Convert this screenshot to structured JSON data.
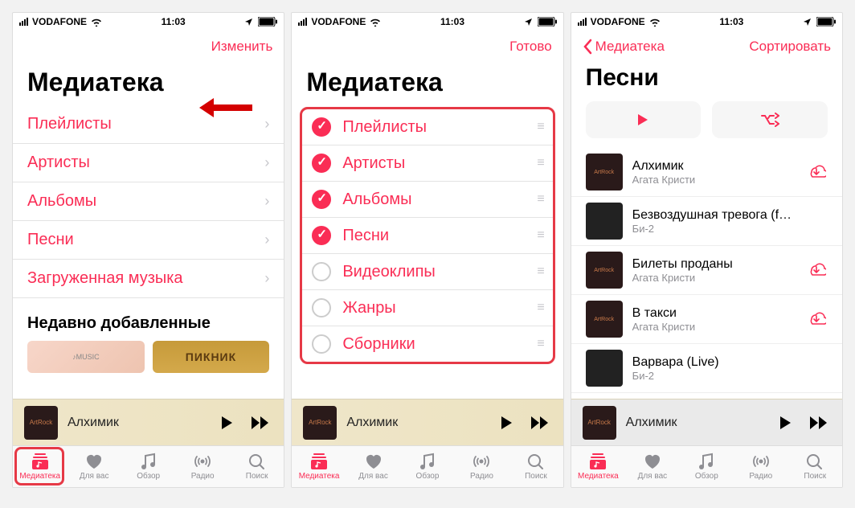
{
  "status": {
    "carrier": "VODAFONE",
    "time": "11:03"
  },
  "colors": {
    "accent": "#fa2d55"
  },
  "screen1": {
    "nav_right": "Изменить",
    "title": "Медиатека",
    "items": [
      "Плейлисты",
      "Артисты",
      "Альбомы",
      "Песни",
      "Загруженная музыка"
    ],
    "recent_header": "Недавно добавленные",
    "recent_album_label": "ПИКНИК"
  },
  "screen2": {
    "nav_right": "Готово",
    "title": "Медиатека",
    "items": [
      {
        "label": "Плейлисты",
        "checked": true
      },
      {
        "label": "Артисты",
        "checked": true
      },
      {
        "label": "Альбомы",
        "checked": true
      },
      {
        "label": "Песни",
        "checked": true
      },
      {
        "label": "Видеоклипы",
        "checked": false
      },
      {
        "label": "Жанры",
        "checked": false
      },
      {
        "label": "Сборники",
        "checked": false
      }
    ]
  },
  "screen3": {
    "nav_back": "Медиатека",
    "nav_right": "Сортировать",
    "title": "Песни",
    "songs": [
      {
        "title": "Алхимик",
        "artist": "Агата Кристи",
        "cloud": true,
        "art": "ak"
      },
      {
        "title": "Безвоздушная тревога (fe…",
        "artist": "Би-2",
        "cloud": false,
        "art": "bi2"
      },
      {
        "title": "Билеты проданы",
        "artist": "Агата Кристи",
        "cloud": true,
        "art": "ak"
      },
      {
        "title": "В такси",
        "artist": "Агата Кристи",
        "cloud": true,
        "art": "ak"
      },
      {
        "title": "Варвара (Live)",
        "artist": "Би-2",
        "cloud": false,
        "art": "bi2"
      }
    ]
  },
  "now_playing": {
    "title": "Алхимик"
  },
  "tabs": [
    {
      "label": "Медиатека",
      "icon": "library"
    },
    {
      "label": "Для вас",
      "icon": "heart"
    },
    {
      "label": "Обзор",
      "icon": "note"
    },
    {
      "label": "Радио",
      "icon": "radio"
    },
    {
      "label": "Поиск",
      "icon": "search"
    }
  ]
}
